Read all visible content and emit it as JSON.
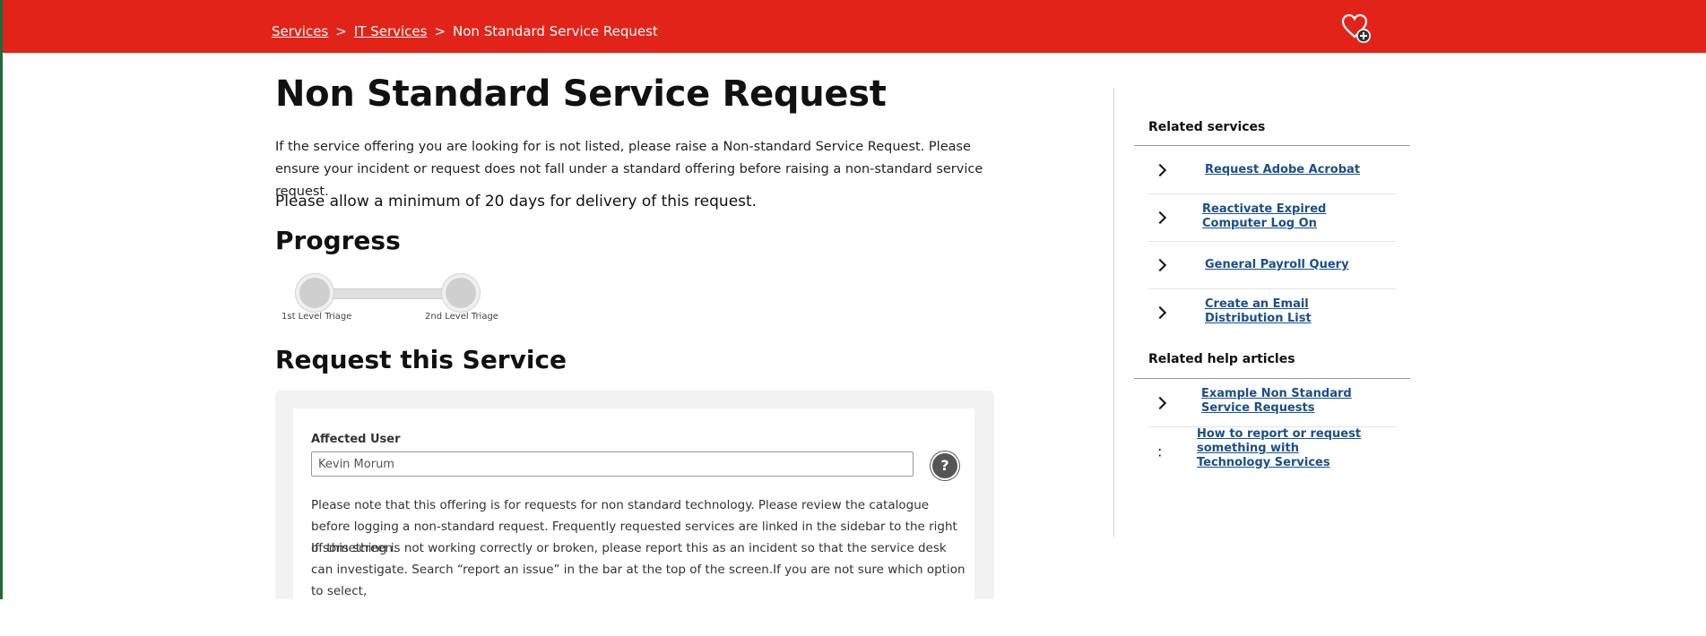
{
  "breadcrumb": {
    "items": [
      "Services",
      "IT Services"
    ],
    "current": "Non Standard Service Request",
    "separator": ">"
  },
  "page": {
    "title": "Non Standard Service Request",
    "intro": "If the service offering you are looking for is not listed, please raise a Non-standard Service Request. Please ensure your incident or request does not fall under a standard offering before raising a non-standard service request.",
    "allow": "Please allow a minimum of 20 days for delivery of this request."
  },
  "progress": {
    "title": "Progress",
    "steps": [
      "1st Level Triage",
      "2nd Level Triage"
    ]
  },
  "request": {
    "title": "Request this Service",
    "affected_user_label": "Affected User",
    "affected_user_value": "Kevin Morum",
    "note1": "Please note that this offering is for requests for non standard technology. Please review the catalogue before logging a non-standard request. Frequently requested services are linked in the sidebar to the right of this screen.",
    "note2": "If something is not working correctly or broken, please report this as an incident so that the service desk can investigate. Search “report an issue” in the bar at the top of the screen.If you are not sure which option to select,"
  },
  "sidebar": {
    "related_services_title": "Related services",
    "related_services": [
      "Request Adobe Acrobat",
      "Reactivate Expired Computer Log On",
      "General Payroll Query",
      "Create an Email Distribution List"
    ],
    "related_help_title": "Related help articles",
    "related_help": [
      "Example Non Standard Service Requests",
      "How to report or request something with Technology Services"
    ]
  },
  "colors": {
    "header": "#e2231a",
    "link": "#1a4f8a"
  },
  "icons": [
    "heart-plus-icon",
    "help-icon",
    "chevron-right-icon"
  ]
}
